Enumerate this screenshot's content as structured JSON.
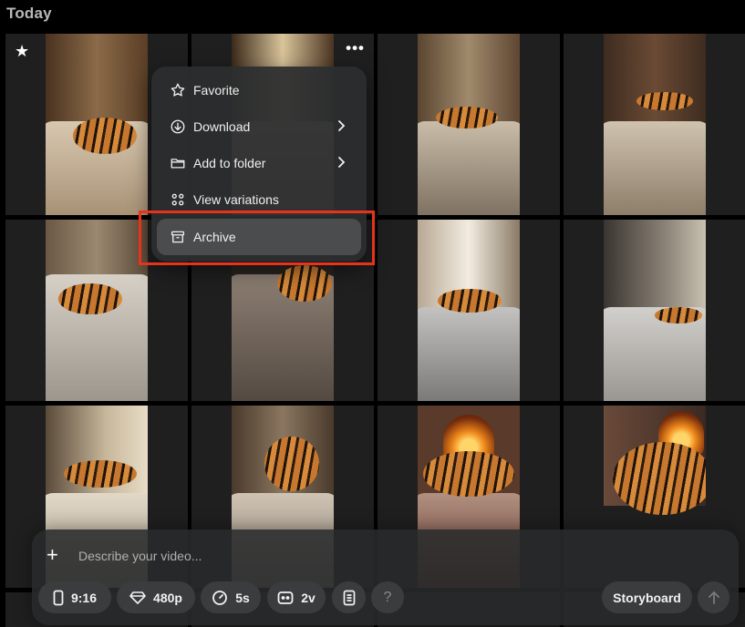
{
  "section": {
    "title": "Today"
  },
  "menu": {
    "items": [
      {
        "label": "Favorite",
        "icon": "star-outline-icon"
      },
      {
        "label": "Download",
        "icon": "download-icon"
      },
      {
        "label": "Add to folder",
        "icon": "folder-icon"
      },
      {
        "label": "View variations",
        "icon": "grid-dots-icon"
      },
      {
        "label": "Archive",
        "icon": "archive-icon"
      }
    ]
  },
  "prompt": {
    "placeholder": "Describe your video...",
    "aspect": "9:16",
    "quality": "480p",
    "duration": "5s",
    "variations": "2v",
    "help": "?",
    "storyboard": "Storyboard"
  },
  "colors": {
    "highlight": "#e8321c",
    "background": "#000000",
    "tile": "#1f1f1f"
  }
}
